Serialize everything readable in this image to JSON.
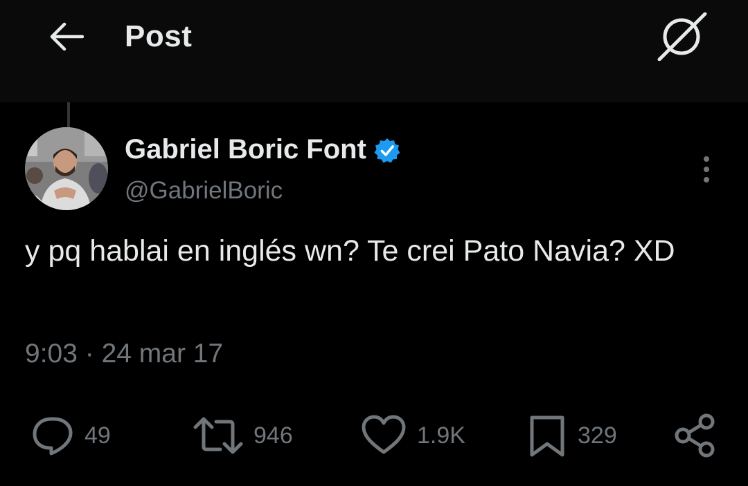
{
  "header": {
    "back_icon": "arrow-left-icon",
    "title": "Post",
    "grok_icon": "grok-icon"
  },
  "author": {
    "name": "Gabriel Boric Font",
    "handle": "@GabrielBoric",
    "verified": true,
    "verified_color": "#1d9bf0",
    "avatar": "profile-photo"
  },
  "post": {
    "text": "y pq hablai en inglés wn? Te crei Pato Navia? XD",
    "time": "9:03",
    "separator": "·",
    "date": "24 mar 17"
  },
  "actions": {
    "replies": "49",
    "reposts": "946",
    "likes": "1.9K",
    "bookmarks": "329"
  },
  "colors": {
    "background": "#000000",
    "text_primary": "#e7e9ea",
    "text_secondary": "#71767b",
    "accent": "#1d9bf0"
  }
}
